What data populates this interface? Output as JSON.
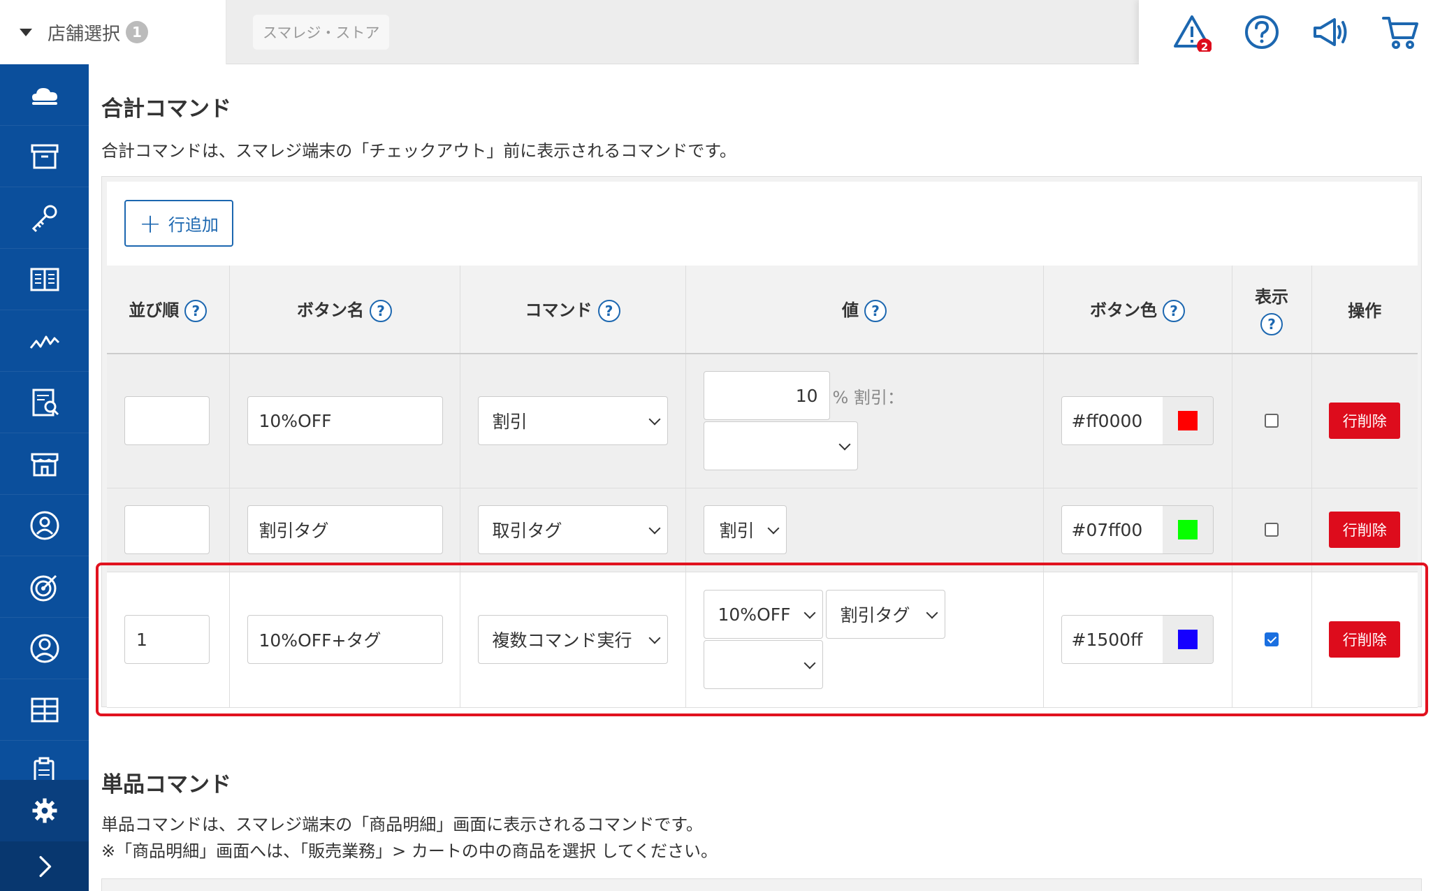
{
  "topbar": {
    "store_select_label": "店舗選択",
    "store_count": "1",
    "store_name": "スマレジ・ストア",
    "alert_count": "2"
  },
  "sidebar": {
    "items": [
      "cloud-icon",
      "archive-icon",
      "key-icon",
      "book-icon",
      "chart-icon",
      "report-icon",
      "store-icon",
      "customer-icon",
      "target-icon",
      "user-icon",
      "grid-icon",
      "clipboard-icon"
    ],
    "accent": "#0b4f9c"
  },
  "total_commands": {
    "title": "合計コマンド",
    "description": "合計コマンドは、スマレジ端末の「チェックアウト」前に表示されるコマンドです。",
    "add_row_label": "行追加",
    "headers": {
      "order": "並び順",
      "button_name": "ボタン名",
      "command": "コマンド",
      "value": "値",
      "button_color": "ボタン色",
      "display": "表示",
      "action": "操作"
    },
    "help_mark": "?",
    "rows": [
      {
        "order": "",
        "button_name": "10%OFF",
        "command": "割引",
        "value_amount": "10",
        "value_suffix": "% 割引：",
        "value_select": "",
        "color": "#ff0000",
        "swatch": "#ff0000",
        "display": false,
        "delete_label": "行削除"
      },
      {
        "order": "",
        "button_name": "割引タグ",
        "command": "取引タグ",
        "value_select": "割引",
        "color": "#07ff00",
        "swatch": "#07ff00",
        "display": false,
        "delete_label": "行削除"
      },
      {
        "order": "1",
        "button_name": "10%OFF+タグ",
        "command": "複数コマンド実行",
        "value_select_1": "10%OFF",
        "value_select_2": "割引タグ",
        "value_select_3": "",
        "color": "#1500ff",
        "swatch": "#1500ff",
        "display": true,
        "delete_label": "行削除"
      }
    ]
  },
  "item_commands": {
    "title": "単品コマンド",
    "description_1": "単品コマンドは、スマレジ端末の「商品明細」画面に表示されるコマンドです。",
    "description_2": "※「商品明細」画面へは、「販売業務」> カートの中の商品を選択 してください。"
  },
  "colors": {
    "primary": "#1c67b0",
    "danger": "#dd0c1c",
    "highlight": "#e1121f"
  }
}
